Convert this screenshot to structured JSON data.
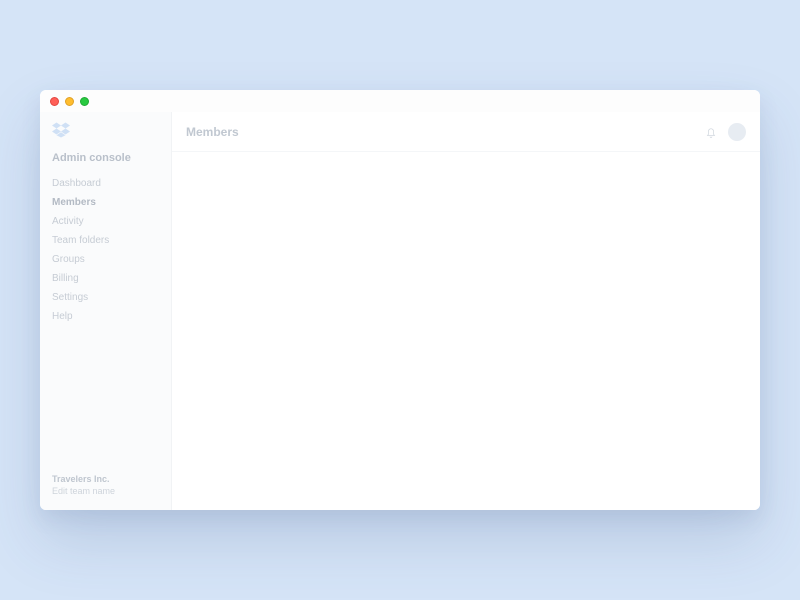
{
  "sidebar": {
    "console_title": "Admin console",
    "items": [
      {
        "label": "Dashboard"
      },
      {
        "label": "Members"
      },
      {
        "label": "Activity"
      },
      {
        "label": "Team folders"
      },
      {
        "label": "Groups"
      },
      {
        "label": "Billing"
      },
      {
        "label": "Settings"
      },
      {
        "label": "Help"
      }
    ],
    "active_index": 1,
    "team_name": "Travelers Inc.",
    "team_sub": "Edit team name"
  },
  "topbar": {
    "page_title": "Members"
  }
}
